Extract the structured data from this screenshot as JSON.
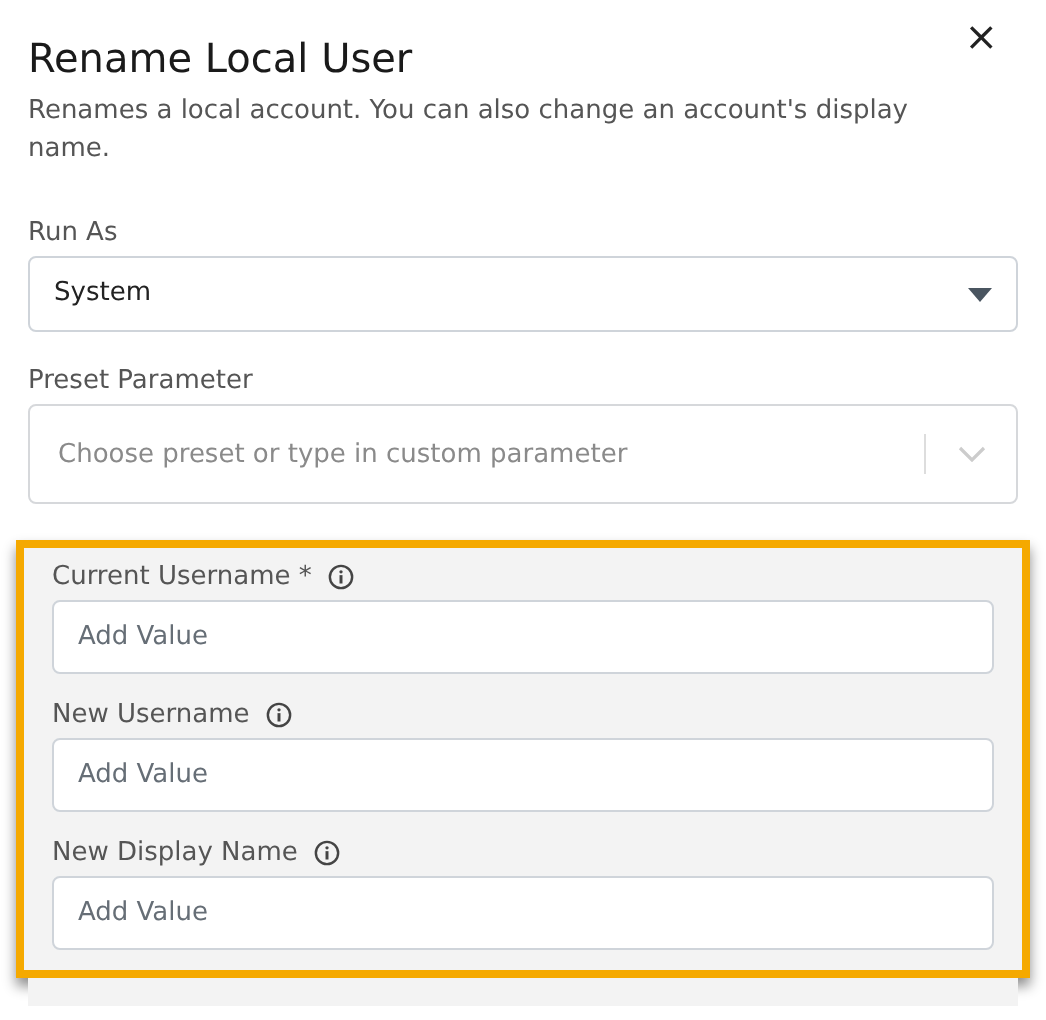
{
  "dialog": {
    "title": "Rename Local User",
    "close": "×",
    "description": "Renames a local account. You can also change an account's display name."
  },
  "run_as": {
    "label": "Run As",
    "value": "System"
  },
  "preset_parameter": {
    "label": "Preset Parameter",
    "placeholder": "Choose preset or type in custom parameter"
  },
  "parameters": {
    "highlighted": true,
    "fields": [
      {
        "label": "Current Username *",
        "placeholder": "Add Value"
      },
      {
        "label": "New Username",
        "placeholder": "Add Value"
      },
      {
        "label": "New Display Name",
        "placeholder": "Add Value"
      }
    ]
  }
}
